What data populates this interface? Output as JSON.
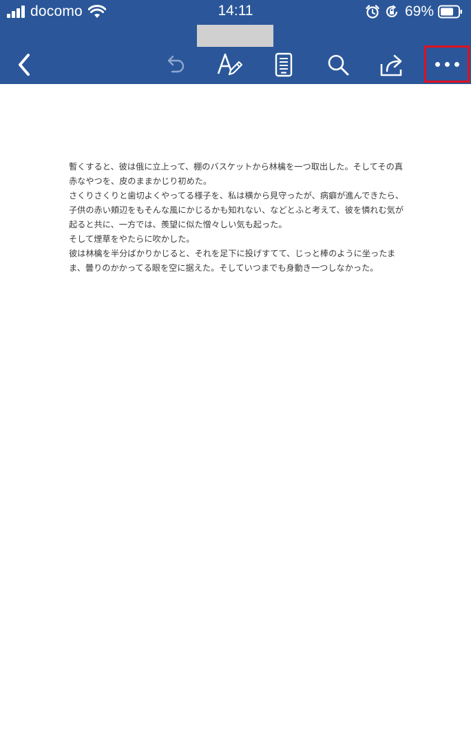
{
  "status_bar": {
    "carrier": "docomo",
    "time": "14:11",
    "battery": "69%",
    "icons": [
      "signal-bars-icon",
      "wifi-icon",
      "alarm-icon",
      "orientation-lock-icon",
      "battery-icon"
    ]
  },
  "document_title": "",
  "toolbar": {
    "buttons": [
      "back-icon",
      "undo-icon",
      "edit-icon",
      "reading-view-icon",
      "search-icon",
      "share-icon",
      "more-icon"
    ],
    "highlight_color": "#e0101e"
  },
  "colors": {
    "header_background": "#2b579a",
    "page_background": "#ffffff",
    "text": "#3a3a3a"
  },
  "document": {
    "paragraphs": [
      "暫くすると、彼は俄に立上って、棚のバスケットから林檎を一つ取出した。そしてその真赤なやつを、皮のままかじり初めた。",
      "さくりさくりと歯切よくやってる様子を、私は横から見守ったが、病癖が進んできたら、子供の赤い頬辺をもそんな風にかじるかも知れない、などとふと考えて、彼を憐れむ気が起ると共に、一方では、羨望に似た憎々しい気も起った。",
      "そして煙草をやたらに吹かした。",
      "彼は林檎を半分ばかりかじると、それを足下に投げすてて、じっと棒のように坐ったまま、曇りのかかってる眼を空に据えた。そしていつまでも身動き一つしなかった。"
    ]
  }
}
